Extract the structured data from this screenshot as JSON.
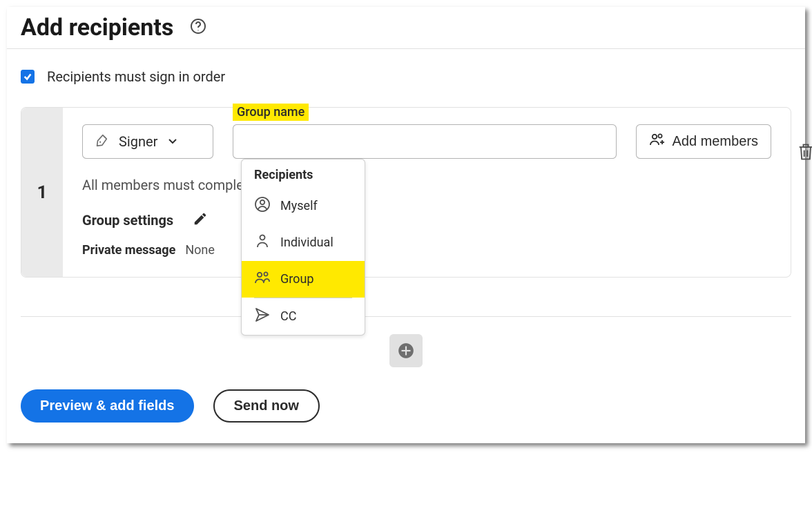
{
  "header": {
    "title": "Add recipients"
  },
  "options": {
    "sign_in_order_label": "Recipients must sign in order"
  },
  "recipient": {
    "order": "1",
    "role": {
      "label": "Signer"
    },
    "group_name_label": "Group name",
    "group_name_value": "",
    "add_members_label": "Add members",
    "completion_text": "All members must complete",
    "settings_label": "Group settings",
    "private_msg_label": "Private message",
    "private_msg_value": "None"
  },
  "popover": {
    "header": "Recipients",
    "items": [
      {
        "label": "Myself",
        "icon": "profile-circle-icon",
        "highlight": false
      },
      {
        "label": "Individual",
        "icon": "person-icon",
        "highlight": false
      },
      {
        "label": "Group",
        "icon": "group-icon",
        "highlight": true
      },
      {
        "label": "CC",
        "icon": "send-icon",
        "highlight": false
      }
    ]
  },
  "footer": {
    "preview_label": "Preview & add fields",
    "send_label": "Send now"
  }
}
